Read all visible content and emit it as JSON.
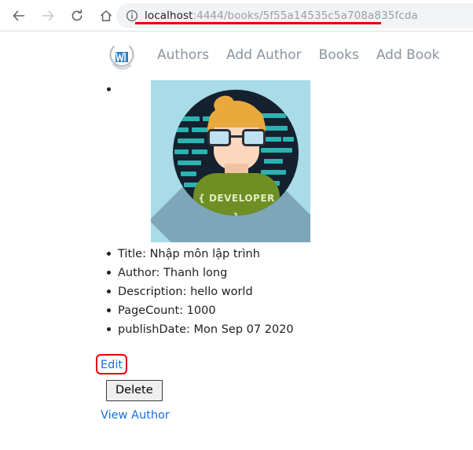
{
  "browser": {
    "toolbar": {
      "back_icon": "back-arrow-icon",
      "forward_icon": "forward-arrow-icon",
      "reload_icon": "reload-icon",
      "home_icon": "home-icon",
      "info_icon": "info-circle-icon"
    },
    "omnibox": {
      "host": "localhost",
      "path": ":4444/books/5f55a14535c5a708a835fcda",
      "full_url": "localhost:4444/books/5f55a14535c5a708a835fcda"
    },
    "annotations": {
      "url_underline_color": "#e60000",
      "edit_highlight_color": "#e60000"
    }
  },
  "site": {
    "logo_alt": "nw-logo",
    "nav": [
      {
        "label": "Authors"
      },
      {
        "label": "Add Author"
      },
      {
        "label": "Books"
      },
      {
        "label": "Add Book"
      }
    ],
    "nav_link_color": "#8a949e"
  },
  "book": {
    "cover": {
      "alt": "developer-illustration",
      "shirt_text": "{ DEVELOPER }",
      "background_color": "#a9dbe8",
      "circle_color": "#15212e",
      "shirt_color": "#6d8f24",
      "hair_color": "#eaa93c",
      "code_color": "#2bb3b3"
    },
    "fields": [
      {
        "label": "Title: Nhập môn lập trình"
      },
      {
        "label": "Author: Thanh long"
      },
      {
        "label": "Description:  hello world"
      },
      {
        "label": "PageCount: 1000"
      },
      {
        "label": "publishDate: Mon Sep 07 2020"
      }
    ]
  },
  "actions": {
    "edit_label": "Edit",
    "delete_label": "Delete",
    "view_author_label": "View Author",
    "link_color": "#1a6ee0"
  }
}
